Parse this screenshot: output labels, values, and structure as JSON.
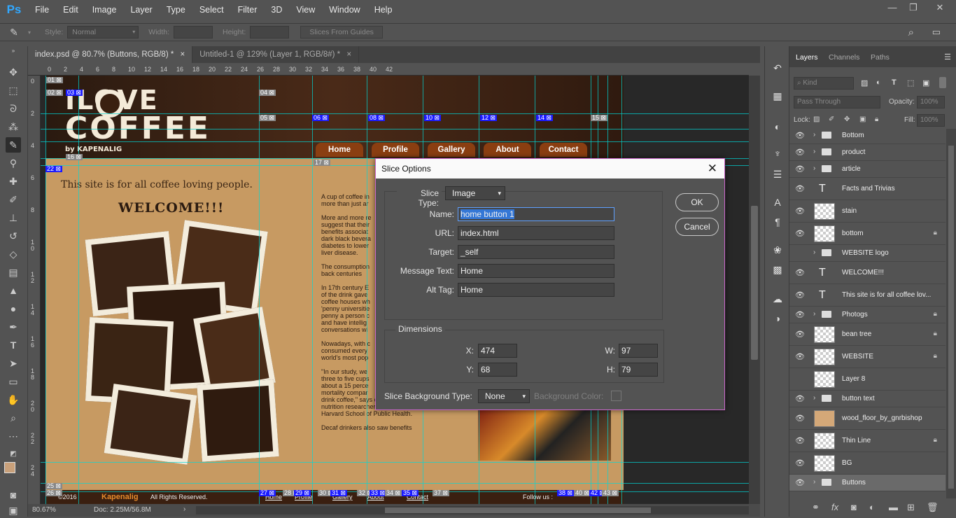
{
  "app": {
    "name": "Ps"
  },
  "menu": [
    "File",
    "Edit",
    "Image",
    "Layer",
    "Type",
    "Select",
    "Filter",
    "3D",
    "View",
    "Window",
    "Help"
  ],
  "window_controls": {
    "minimize": "—",
    "restore": "❐",
    "close": "✕"
  },
  "options_bar": {
    "style_label": "Style:",
    "style_value": "Normal",
    "width_label": "Width:",
    "height_label": "Height:",
    "slices_button": "Slices From Guides"
  },
  "tabs": [
    {
      "label": "index.psd @ 80.7% (Buttons, RGB/8) *",
      "close": "×",
      "active": true
    },
    {
      "label": "Untitled-1 @ 129% (Layer 1, RGB/8#) *",
      "close": "×",
      "active": false
    }
  ],
  "ruler_top": [
    "0",
    "2",
    "4",
    "6",
    "8",
    "10",
    "12",
    "14",
    "16",
    "18",
    "20",
    "22",
    "24",
    "26",
    "28",
    "30",
    "32",
    "34",
    "36",
    "38",
    "40",
    "42"
  ],
  "ruler_left": [
    "0",
    "2",
    "4",
    "6",
    "8",
    "1\n0",
    "1\n2",
    "1\n4",
    "1\n6",
    "1\n8",
    "2\n0",
    "2\n2",
    "2\n4"
  ],
  "canvas": {
    "site": {
      "logo_line1": "ILOVE",
      "logo_line2": "COFFEE",
      "byline": "by KAPENALIG",
      "tagline": "This site is for all coffee loving people.",
      "welcome": "WELCOME!!!",
      "nav": [
        "Home",
        "Profile",
        "Gallery",
        "About",
        "Contact"
      ],
      "article_paragraphs": [
        "A cup of coffee in",
        "more than just ar",
        "More and more re",
        "suggest that their",
        "benefits associat",
        "dark black bevera",
        "diabetes to lower",
        "liver disease.",
        "The consumption",
        "back centuries",
        "In 17th century E",
        "of the drink gave",
        "coffee houses wh",
        "'penny universitie",
        "penny a person c",
        "and have intellig",
        "conversations wi",
        "Nowadays, with c",
        "consumed every",
        "world's most pop",
        "\"In our study, we",
        "three to five cups",
        "about a 15 perce",
        "mortality compar",
        "drink coffee,\" says one of the study authors,",
        "nutrition researcher Walter Willett of the",
        "Harvard School of Public Health.",
        "Decaf drinkers also saw benefits"
      ],
      "footer_copyright": "©2016",
      "footer_brand": "Kapenalig",
      "footer_rights": "All Rights Reserved.",
      "footer_nav": [
        "Home",
        "Profile",
        "Gallery",
        "About",
        "Contact"
      ],
      "footer_follow": "Follow us :"
    },
    "slices": [
      {
        "n": "01",
        "t": "auto"
      },
      {
        "n": "02",
        "t": "auto"
      },
      {
        "n": "03",
        "t": "user"
      },
      {
        "n": "04",
        "t": "auto"
      },
      {
        "n": "05",
        "t": "auto"
      },
      {
        "n": "06",
        "t": "user"
      },
      {
        "n": "08",
        "t": "user"
      },
      {
        "n": "10",
        "t": "user"
      },
      {
        "n": "12",
        "t": "user"
      },
      {
        "n": "14",
        "t": "user"
      },
      {
        "n": "15",
        "t": "auto"
      },
      {
        "n": "16",
        "t": "auto"
      },
      {
        "n": "17",
        "t": "auto"
      },
      {
        "n": "22",
        "t": "user"
      },
      {
        "n": "25",
        "t": "auto"
      },
      {
        "n": "26",
        "t": "auto"
      },
      {
        "n": "27",
        "t": "user"
      },
      {
        "n": "28",
        "t": "auto"
      },
      {
        "n": "29",
        "t": "user"
      },
      {
        "n": "30",
        "t": "auto"
      },
      {
        "n": "31",
        "t": "user"
      },
      {
        "n": "32",
        "t": "auto"
      },
      {
        "n": "33",
        "t": "user"
      },
      {
        "n": "34",
        "t": "auto"
      },
      {
        "n": "35",
        "t": "user"
      },
      {
        "n": "37",
        "t": "auto"
      },
      {
        "n": "38",
        "t": "user"
      },
      {
        "n": "40",
        "t": "auto"
      },
      {
        "n": "42",
        "t": "user"
      },
      {
        "n": "43",
        "t": "auto"
      }
    ]
  },
  "status": {
    "zoom": "80.67%",
    "doc": "Doc: 2.25M/56.8M"
  },
  "dialog": {
    "title": "Slice Options",
    "slice_type_label": "Slice Type:",
    "slice_type_value": "Image",
    "name_label": "Name:",
    "name_value": "home button 1",
    "url_label": "URL:",
    "url_value": "index.html",
    "target_label": "Target:",
    "target_value": "_self",
    "message_label": "Message Text:",
    "message_value": "Home",
    "alt_label": "Alt Tag:",
    "alt_value": "Home",
    "dimensions_label": "Dimensions",
    "x_label": "X:",
    "x_value": "474",
    "y_label": "Y:",
    "y_value": "68",
    "w_label": "W:",
    "w_value": "97",
    "h_label": "H:",
    "h_value": "79",
    "bg_type_label": "Slice Background Type:",
    "bg_type_value": "None",
    "bg_color_label": "Background Color:",
    "ok": "OK",
    "cancel": "Cancel"
  },
  "layers_panel": {
    "tabs": [
      "Layers",
      "Channels",
      "Paths"
    ],
    "kind": "Kind",
    "blend_mode": "Pass Through",
    "opacity_label": "Opacity:",
    "opacity_value": "100%",
    "lock_label": "Lock:",
    "fill_label": "Fill:",
    "fill_value": "100%",
    "layers": [
      {
        "name": "Bottom",
        "type": "group",
        "visible": true,
        "locked": false
      },
      {
        "name": "product",
        "type": "group",
        "visible": true,
        "locked": false
      },
      {
        "name": "article",
        "type": "group",
        "visible": true,
        "locked": false
      },
      {
        "name": "Facts and Trivias",
        "type": "text",
        "visible": true,
        "locked": false
      },
      {
        "name": "stain",
        "type": "image",
        "visible": true,
        "locked": false
      },
      {
        "name": "bottom",
        "type": "smart",
        "visible": true,
        "locked": true
      },
      {
        "name": "WEBSITE logo",
        "type": "group",
        "visible": false,
        "locked": false
      },
      {
        "name": "WELCOME!!!",
        "type": "text",
        "visible": true,
        "locked": false
      },
      {
        "name": "This site is for all coffee lov...",
        "type": "text",
        "visible": true,
        "locked": false
      },
      {
        "name": "Photogs",
        "type": "group",
        "visible": true,
        "locked": true
      },
      {
        "name": "bean tree",
        "type": "smart",
        "visible": true,
        "locked": true
      },
      {
        "name": "WEBSITE",
        "type": "smart",
        "visible": true,
        "locked": true
      },
      {
        "name": "Layer 8",
        "type": "image",
        "visible": false,
        "locked": false
      },
      {
        "name": "button text",
        "type": "group",
        "visible": true,
        "locked": false
      },
      {
        "name": "wood_floor_by_gnrbishop",
        "type": "smart",
        "visible": true,
        "locked": false
      },
      {
        "name": "Thin Line",
        "type": "smart",
        "visible": true,
        "locked": true
      },
      {
        "name": "BG",
        "type": "image",
        "visible": true,
        "locked": false
      },
      {
        "name": "Buttons",
        "type": "group",
        "visible": true,
        "locked": false
      }
    ]
  },
  "colors": {
    "accent": "#31a8ff",
    "guide": "#00d8d8",
    "slice_user": "#1a1aff",
    "dialog_border": "#cc66cc",
    "foreground_swatch": "#c8a07a"
  }
}
